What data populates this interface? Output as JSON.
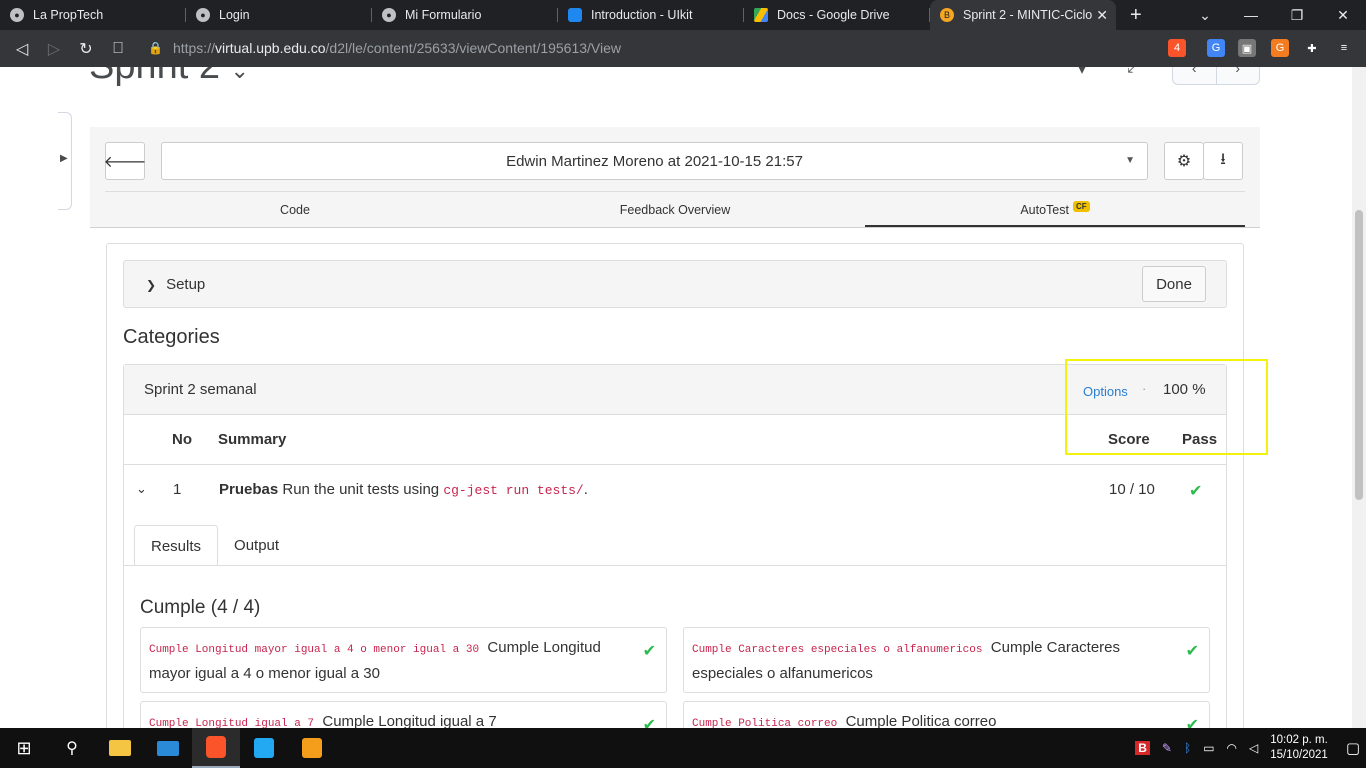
{
  "browser": {
    "tabs": [
      {
        "title": "La PropTech",
        "icon": "globe-icon",
        "color": "#bdc1c6"
      },
      {
        "title": "Login",
        "icon": "globe-icon",
        "color": "#bdc1c6"
      },
      {
        "title": "Mi Formulario",
        "icon": "globe-icon",
        "color": "#bdc1c6"
      },
      {
        "title": "Introduction - UIkit",
        "icon": "uikit-icon",
        "color": "#1e87f0"
      },
      {
        "title": "Docs - Google Drive",
        "icon": "drive-icon",
        "color": "#fbbc04"
      },
      {
        "title": "Sprint 2 - MINTIC-Ciclo",
        "icon": "site-icon",
        "color": "#f5a623"
      }
    ],
    "url_prefix": "https://",
    "url_domain": "virtual.upb.edu.co",
    "url_path": "/d2l/le/content/25633/viewContent/195613/View",
    "brave_badge": "4"
  },
  "page": {
    "title": "Sprint 2",
    "submission": "Edwin Martinez Moreno at 2021-10-15 21:57",
    "subtabs": [
      "Code",
      "Feedback Overview",
      "AutoTest"
    ],
    "autotest_badge": "CF",
    "setup_label": "Setup",
    "done_label": "Done",
    "categories_heading": "Categories",
    "category": {
      "name": "Sprint 2 semanal",
      "options_label": "Options",
      "dot": "·",
      "percent": "100 %",
      "columns": {
        "no": "No",
        "summary": "Summary",
        "score": "Score",
        "pass": "Pass"
      },
      "row": {
        "no": "1",
        "name": "Pruebas",
        "desc": "Run the unit tests using",
        "code": "cg-jest run tests/",
        "end": ".",
        "score": "10 / 10"
      },
      "result_tabs": [
        "Results",
        "Output"
      ],
      "cumple_heading": "Cumple (4 / 4)",
      "tests": [
        {
          "code": "Cumple Longitud mayor igual a 4 o menor igual a 30",
          "text": "Cumple Longitud mayor igual a 4 o menor igual a 30"
        },
        {
          "code": "Cumple Caracteres especiales o alfanumericos",
          "text": "Cumple Caracteres especiales o alfanumericos"
        },
        {
          "code": "Cumple Longitud igual a 7",
          "text": "Cumple Longitud igual a 7"
        },
        {
          "code": "Cumple Politica correo",
          "text": "Cumple Politica correo"
        }
      ]
    }
  },
  "taskbar": {
    "time": "10:02 p. m.",
    "date": "15/10/2021"
  },
  "colors": {
    "highlight": "#f2f20a",
    "pass": "#2dba4e",
    "link": "#2a7ed2"
  }
}
